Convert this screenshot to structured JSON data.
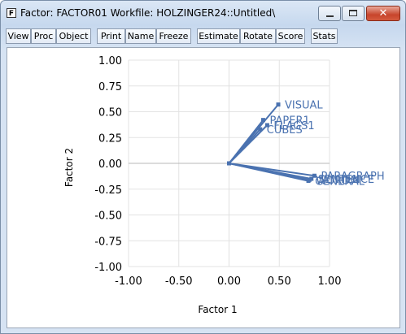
{
  "window": {
    "title": "Factor: FACTOR01   Workfile: HOLZINGER24::Untitled\\",
    "icon_letter": "F",
    "buttons": [
      "minimize-icon",
      "maximize-icon",
      "close-icon"
    ],
    "close_glyph": "✕"
  },
  "toolbar": {
    "buttons": [
      "View",
      "Proc",
      "Object",
      "Print",
      "Name",
      "Freeze",
      "Estimate",
      "Rotate",
      "Score",
      "Stats"
    ]
  },
  "chart_data": {
    "type": "scatter",
    "xlabel": "Factor 1",
    "ylabel": "Factor 2",
    "xlim": [
      -1.0,
      1.0
    ],
    "ylim": [
      -1.0,
      1.0
    ],
    "xticks": [
      "-1.00",
      "-0.50",
      "0.00",
      "0.50",
      "1.00"
    ],
    "yticks": [
      "1.00",
      "0.75",
      "0.50",
      "0.25",
      "0.00",
      "-0.25",
      "-0.50",
      "-0.75",
      "-1.00"
    ],
    "origin_lines": true,
    "series_color": "#4a72b0",
    "points": [
      {
        "label": "VISUAL",
        "x": 0.49,
        "y": 0.57
      },
      {
        "label": "PAPER1",
        "x": 0.34,
        "y": 0.42
      },
      {
        "label": "FLAGS1",
        "x": 0.38,
        "y": 0.37
      },
      {
        "label": "CUBES",
        "x": 0.31,
        "y": 0.33
      },
      {
        "label": "PARAGRAPH",
        "x": 0.85,
        "y": -0.12
      },
      {
        "label": "SENTENCE",
        "x": 0.82,
        "y": -0.15
      },
      {
        "label": "WORDM",
        "x": 0.8,
        "y": -0.16
      },
      {
        "label": "GENERAL",
        "x": 0.79,
        "y": -0.17
      }
    ]
  }
}
